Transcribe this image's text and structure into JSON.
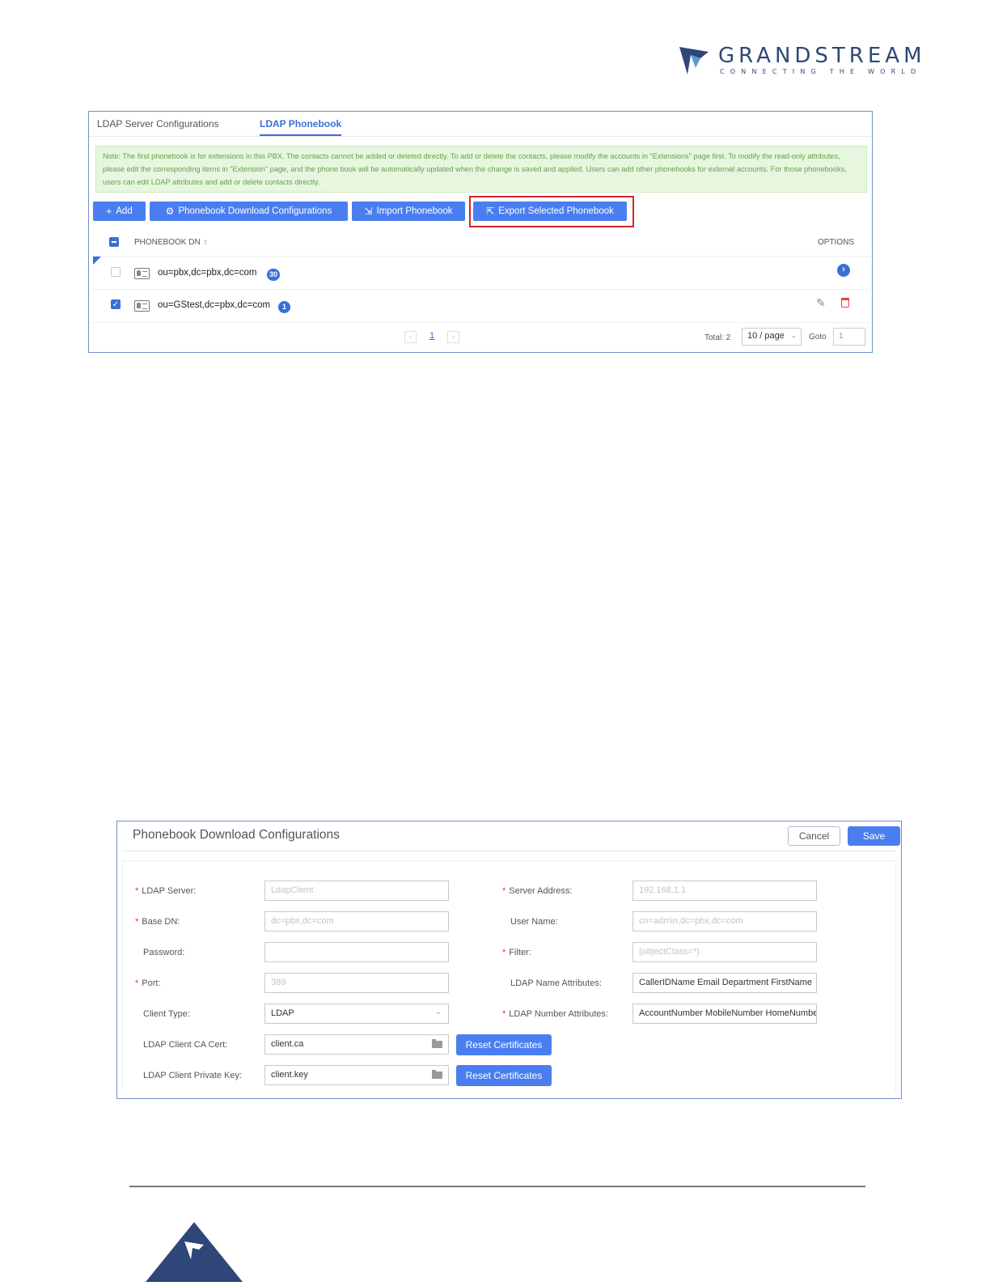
{
  "brand": {
    "name": "GRANDSTREAM",
    "tagline": "CONNECTING THE WORLD",
    "color": "#2f4778"
  },
  "phonebook_panel": {
    "tabs": [
      {
        "label": "LDAP Server Configurations",
        "active": false
      },
      {
        "label": "LDAP Phonebook",
        "active": true
      }
    ],
    "note": "Note: The first phonebook is for extensions in this PBX. The contacts cannot be added or deleted directly. To add or delete the contacts, please modify the accounts in \"Extensions\" page first. To modify the read-only attributes, please edit the corresponding items in \"Extension\" page, and the phone book will be automatically updated when the change is saved and applied. Users can add other phonebooks for external accounts. For those phonebooks, users can edit LDAP attributes and add or delete contacts directly.",
    "toolbar": {
      "add": "Add",
      "download_config": "Phonebook Download Configurations",
      "import": "Import Phonebook",
      "export": "Export Selected Phonebook"
    },
    "columns": {
      "dn": "PHONEBOOK DN",
      "options": "OPTIONS"
    },
    "rows": [
      {
        "dn": "ou=pbx,dc=pbx,dc=com",
        "count": "30",
        "checked": false
      },
      {
        "dn": "ou=GStest,dc=pbx,dc=com",
        "count": "1",
        "checked": true
      }
    ],
    "pagination": {
      "current_page": "1",
      "total": "Total: 2",
      "page_size": "10 / page",
      "goto_label": "Goto",
      "goto_value": "1"
    },
    "accent_color": "#4a7ef0",
    "highlight_color": "#d0282b"
  },
  "download_config": {
    "title": "Phonebook Download Configurations",
    "cancel": "Cancel",
    "save": "Save",
    "fields": {
      "ldap_server": {
        "label": "LDAP Server:",
        "value": "LdapClient"
      },
      "server_address": {
        "label": "Server Address:",
        "value": "192.168.1.1"
      },
      "base_dn": {
        "label": "Base DN:",
        "value": "dc=pbx,dc=com"
      },
      "user_name": {
        "label": "User Name:",
        "value": "cn=admin,dc=pbx,dc=com"
      },
      "password": {
        "label": "Password:",
        "value": ""
      },
      "filter": {
        "label": "Filter:",
        "value": "(objectClass=*)"
      },
      "port": {
        "label": "Port:",
        "value": "389"
      },
      "name_attrs": {
        "label": "LDAP Name Attributes:",
        "value": "CallerIDName Email Department FirstName"
      },
      "client_type": {
        "label": "Client Type:",
        "value": "LDAP"
      },
      "number_attrs": {
        "label": "LDAP Number Attributes:",
        "value": "AccountNumber MobileNumber HomeNumber"
      },
      "ca_cert": {
        "label": "LDAP Client CA Cert:",
        "value": "client.ca"
      },
      "private_key": {
        "label": "LDAP Client Private Key:",
        "value": "client.key"
      }
    },
    "reset_button": "Reset Certificates"
  }
}
